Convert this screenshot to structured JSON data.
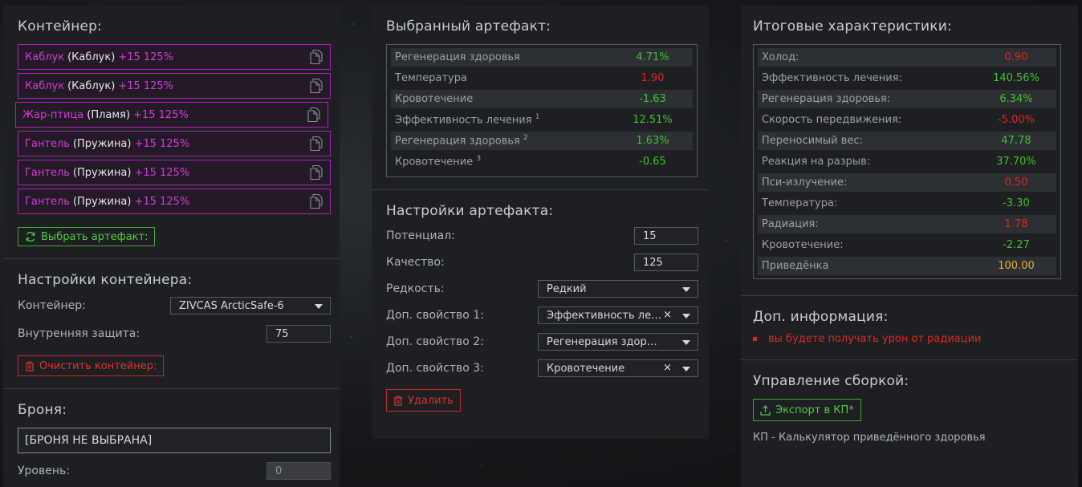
{
  "container_panel": {
    "title": "Контейнер:",
    "artifacts": [
      {
        "name": "Каблук",
        "type": "(Каблук)",
        "potential": "+15 125%"
      },
      {
        "name": "Каблук",
        "type": "(Каблук)",
        "potential": "+15 125%"
      },
      {
        "name": "Жар-птица",
        "type": "(Пламя)",
        "potential": "+15 125%"
      },
      {
        "name": "Гантель",
        "type": "(Пружина)",
        "potential": "+15 125%"
      },
      {
        "name": "Гантель",
        "type": "(Пружина)",
        "potential": "+15 125%"
      },
      {
        "name": "Гантель",
        "type": "(Пружина)",
        "potential": "+15 125%"
      }
    ],
    "select_artifact_label": "Выбрать артефакт:",
    "settings_title": "Настройки контейнера:",
    "container_label": "Контейнер:",
    "container_value": "ZIVCAS ArcticSafe-6",
    "inner_protection_label": "Внутренняя защита:",
    "inner_protection_value": "75",
    "clear_label": "Очистить контейнер:",
    "armor_title": "Броня:",
    "armor_value": "[БРОНЯ НЕ ВЫБРАНА]",
    "level_label": "Уровень:",
    "level_value": "0"
  },
  "artifact_panel": {
    "title": "Выбранный артефакт:",
    "stats": [
      {
        "label": "Регенерация здоровья",
        "sup": "",
        "value": "4.71%",
        "color": "green"
      },
      {
        "label": "Температура",
        "sup": "",
        "value": "1.90",
        "color": "red"
      },
      {
        "label": "Кровотечение",
        "sup": "",
        "value": "-1.63",
        "color": "green"
      },
      {
        "label": "Эффективность лечения",
        "sup": "1",
        "value": "12.51%",
        "color": "green"
      },
      {
        "label": "Регенерация здоровья",
        "sup": "2",
        "value": "1.63%",
        "color": "green"
      },
      {
        "label": "Кровотечение",
        "sup": "3",
        "value": "-0.65",
        "color": "green"
      }
    ],
    "settings_title": "Настройки артефакта:",
    "potential_label": "Потенциал:",
    "potential_value": "15",
    "quality_label": "Качество:",
    "quality_value": "125",
    "rarity_label": "Редкость:",
    "rarity_value": "Редкий",
    "extra1_label": "Доп. свойство 1:",
    "extra1_value": "Эффективность ле…",
    "extra2_label": "Доп. свойство 2:",
    "extra2_value": "Регенерация здор…",
    "extra3_label": "Доп. свойство 3:",
    "extra3_value": "Кровотечение",
    "delete_label": "Удалить",
    "clear_glyph": "×"
  },
  "summary_panel": {
    "title": "Итоговые характеристики:",
    "stats": [
      {
        "label": "Холод:",
        "value": "0.90",
        "color": "red"
      },
      {
        "label": "Эффективность лечения:",
        "value": "140.56%",
        "color": "green"
      },
      {
        "label": "Регенерация здоровья:",
        "value": "6.34%",
        "color": "green"
      },
      {
        "label": "Скорость передвижения:",
        "value": "-5.00%",
        "color": "red"
      },
      {
        "label": "Переносимый вес:",
        "value": "47.78",
        "color": "green"
      },
      {
        "label": "Реакция на разрыв:",
        "value": "37.70%",
        "color": "green"
      },
      {
        "label": "Пси-излучение:",
        "value": "0.50",
        "color": "red"
      },
      {
        "label": "Температура:",
        "value": "-3.30",
        "color": "green"
      },
      {
        "label": "Радиация:",
        "value": "1.78",
        "color": "red"
      },
      {
        "label": "Кровотечение:",
        "value": "-2.27",
        "color": "green"
      },
      {
        "label": "Приведёнка",
        "value": "100.00",
        "color": "yellow"
      }
    ],
    "info_title": "Доп. информация:",
    "info_items": [
      "вы будете получать урон от радиации"
    ],
    "build_title": "Управление сборкой:",
    "export_label": "Экспорт в КП*",
    "footnote": "КП - Калькулятор приведённого здоровья"
  },
  "colors": {
    "green": "#41c22e",
    "red": "#d92a22",
    "yellow": "#e7b12a",
    "magenta": "#d23cd8"
  }
}
